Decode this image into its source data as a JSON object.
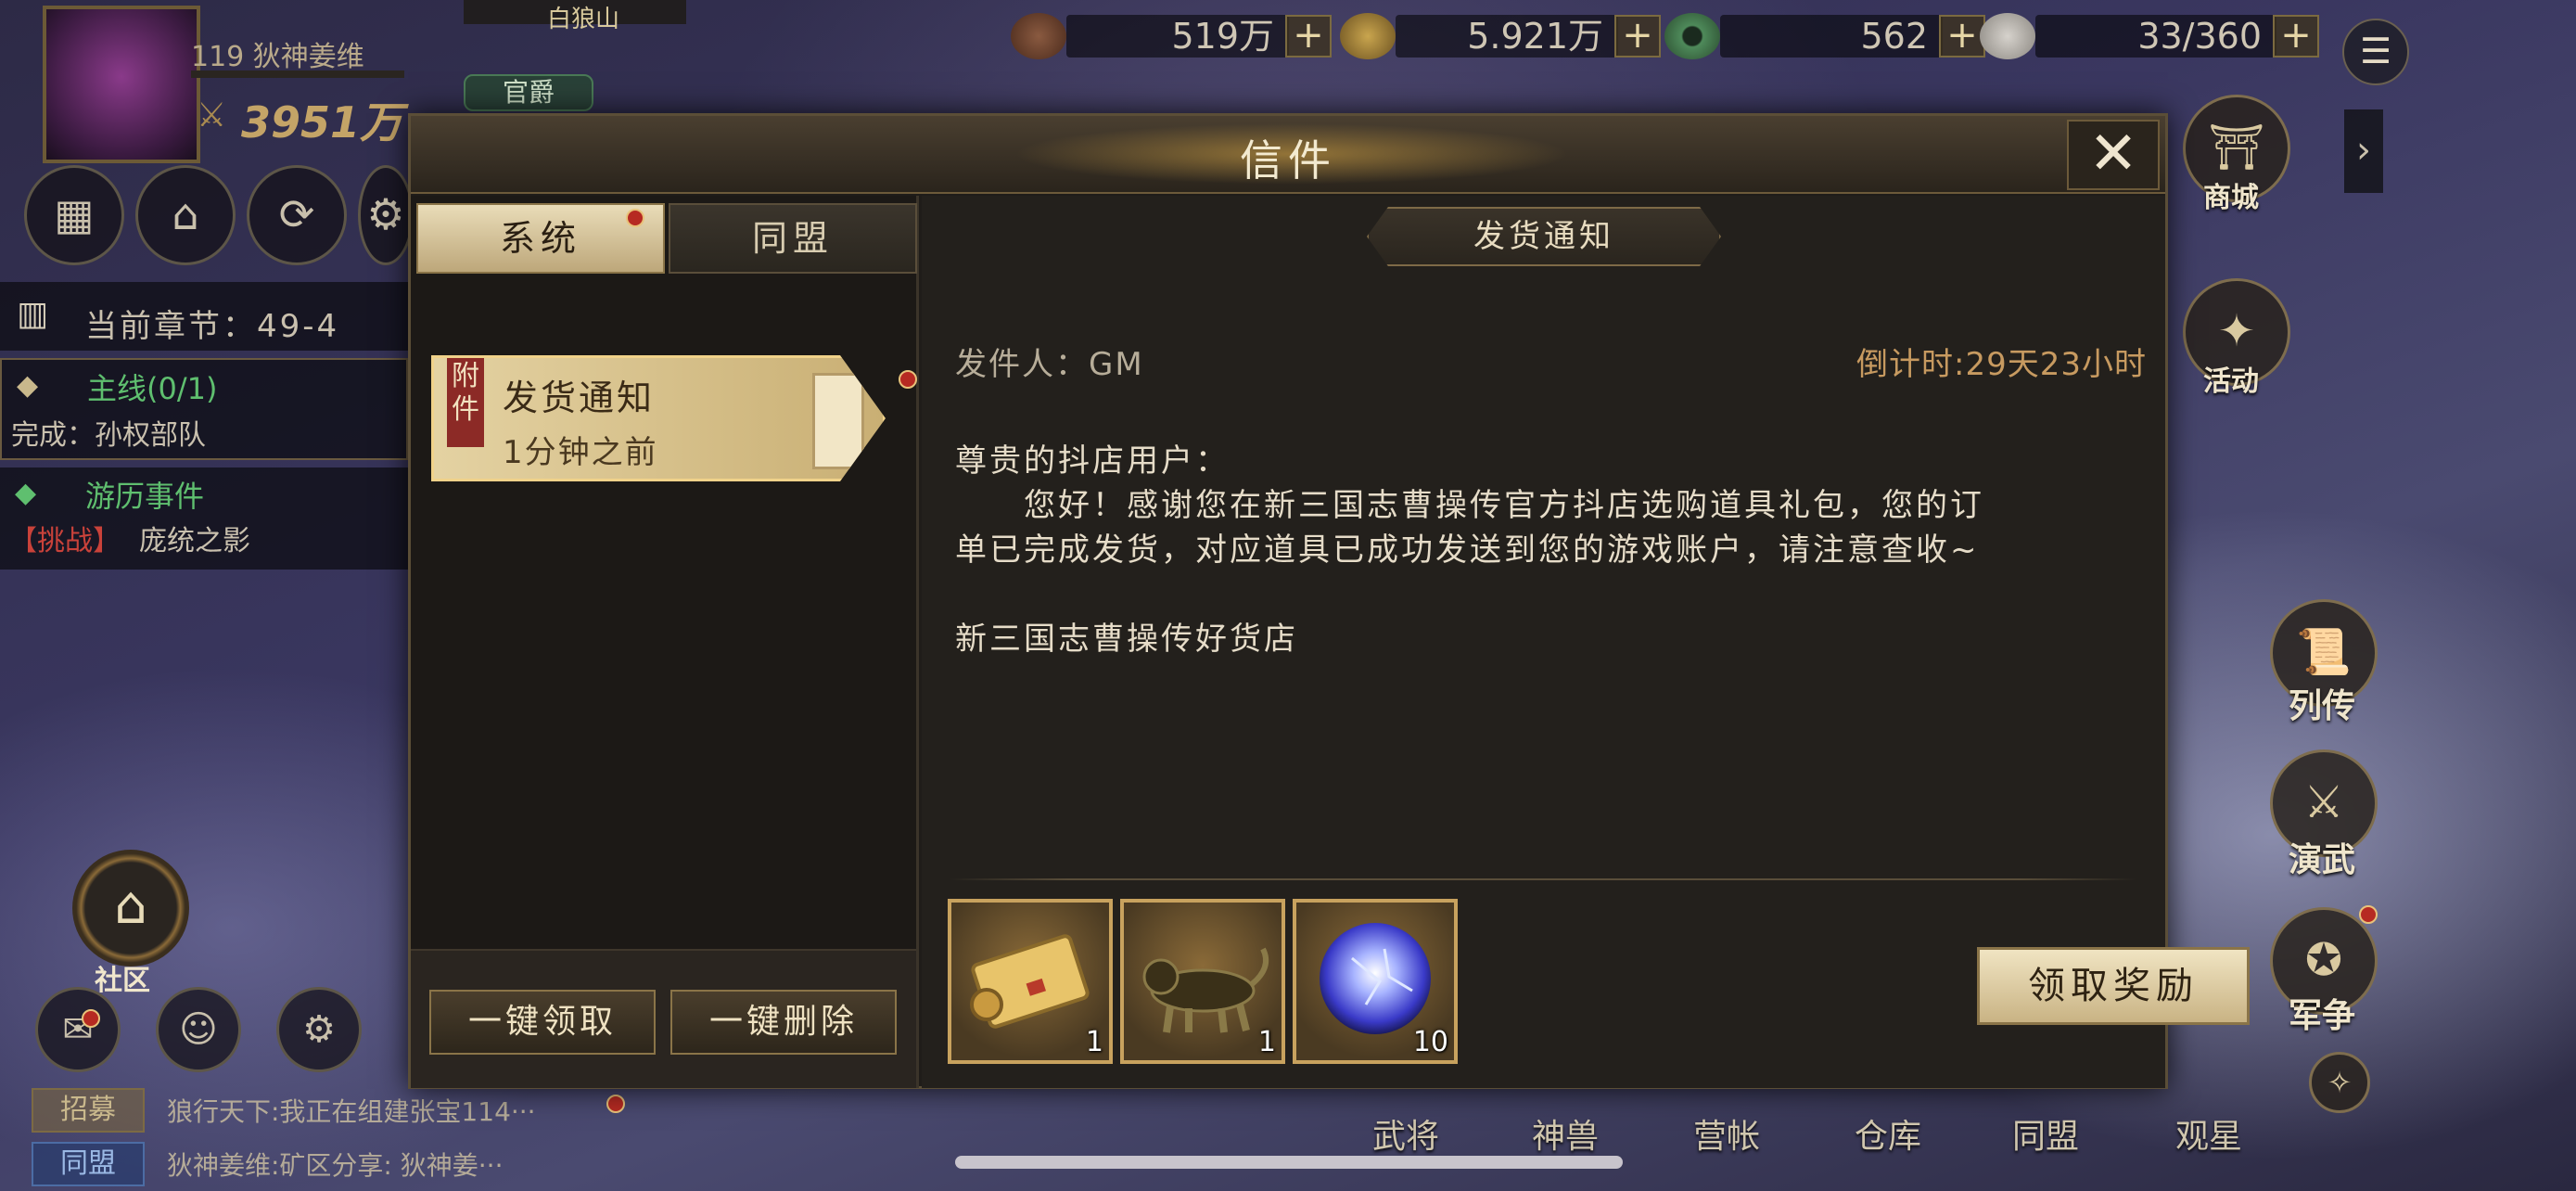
{
  "resources": [
    {
      "name": "copper-coins-icon",
      "value": "519万"
    },
    {
      "name": "gold-coin-icon",
      "value": "5.921万"
    },
    {
      "name": "jade-icon",
      "value": "562"
    },
    {
      "name": "grain-icon",
      "value": "33/360"
    }
  ],
  "resources_plus": "+",
  "player": {
    "name": "119 狄神姜维",
    "power": "3951万",
    "location": "白狼山",
    "rank": "官爵"
  },
  "quests": {
    "chapter": "当前章节：49-4",
    "main_line": "主线(0/1)",
    "main_desc": "完成：孙权部队",
    "event": "游历事件",
    "event_tag": "【挑战】",
    "event_desc": "庞统之影"
  },
  "community_label": "社区",
  "chat": [
    {
      "tag": "招募",
      "message": "狼行天下:我正在组建张宝114···"
    },
    {
      "tag": "同盟",
      "message": "狄神姜维:矿区分享: 狄神姜···"
    }
  ],
  "side_buttons": {
    "shop": "商城",
    "events": "活动",
    "biography": "列传",
    "drill": "演武",
    "war": "军争"
  },
  "bottom_nav": [
    "武将",
    "神兽",
    "营帐",
    "仓库",
    "同盟",
    "观星"
  ],
  "dialog": {
    "title": "信件",
    "close_symbol": "✕",
    "tabs": [
      "系统",
      "同盟"
    ],
    "mail_item": {
      "badge": "附件",
      "subject": "发货通知",
      "time": "1分钟之前"
    },
    "footer": {
      "claim_all": "一键领取",
      "delete_all": "一键删除"
    },
    "mail": {
      "subject": "发货通知",
      "sender": "发件人：GM",
      "countdown": "倒计时:29天23小时",
      "greeting": "尊贵的抖店用户：",
      "line1": "　　您好！感谢您在新三国志曹操传官方抖店选购道具礼包，您的订",
      "line2": "单已完成发货，对应道具已成功发送到您的游戏账户，请注意查收~",
      "signature": "新三国志曹操传好货店"
    },
    "rewards": [
      {
        "icon": "scroll-icon",
        "count": "1"
      },
      {
        "icon": "bronze-beast-icon",
        "count": "1"
      },
      {
        "icon": "energy-orb-icon",
        "count": "10"
      }
    ],
    "claim_button": "领取奖励"
  }
}
